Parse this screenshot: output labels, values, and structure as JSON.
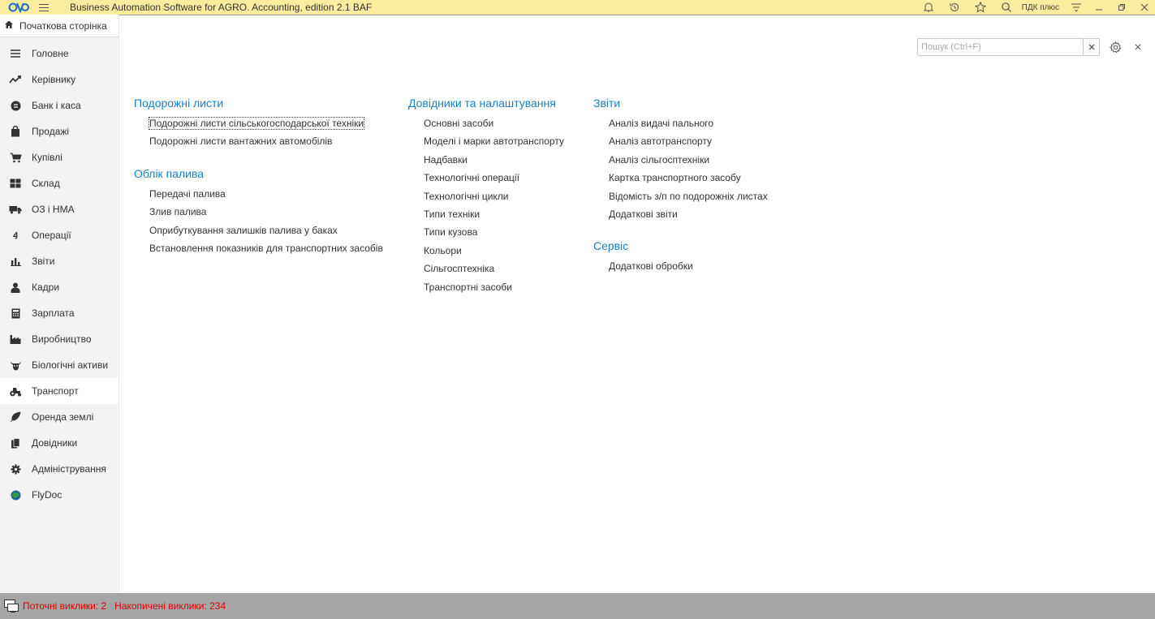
{
  "titlebar": {
    "title": "Business Automation Software for AGRO. Accounting, edition 2.1 BAF",
    "user": "ПДК плюс"
  },
  "sidebar": {
    "home_tab": "Початкова сторінка",
    "items": [
      {
        "label": "Головне",
        "icon": "menu-lines-icon"
      },
      {
        "label": "Керівнику",
        "icon": "trend-chart-icon"
      },
      {
        "label": "Банк і каса",
        "icon": "bank-coin-icon"
      },
      {
        "label": "Продажі",
        "icon": "shopping-bag-icon"
      },
      {
        "label": "Купівлі",
        "icon": "cart-icon"
      },
      {
        "label": "Склад",
        "icon": "warehouse-icon"
      },
      {
        "label": "ОЗ і НМА",
        "icon": "truck-icon"
      },
      {
        "label": "Операції",
        "icon": "operations-icon"
      },
      {
        "label": "Звіти",
        "icon": "bar-chart-icon"
      },
      {
        "label": "Кадри",
        "icon": "person-icon"
      },
      {
        "label": "Зарплата",
        "icon": "calculator-icon"
      },
      {
        "label": "Виробництво",
        "icon": "factory-icon"
      },
      {
        "label": "Біологічні активи",
        "icon": "cow-icon"
      },
      {
        "label": "Транспорт",
        "icon": "tractor-icon",
        "active": true
      },
      {
        "label": "Оренда землі",
        "icon": "feather-icon"
      },
      {
        "label": "Довідники",
        "icon": "books-icon"
      },
      {
        "label": "Адміністрування",
        "icon": "gear-icon"
      },
      {
        "label": "FlyDoc",
        "icon": "flydoc-icon"
      }
    ]
  },
  "search": {
    "placeholder": "Пошук (Ctrl+F)",
    "value": ""
  },
  "columns": [
    {
      "groups": [
        {
          "title": "Подорожні листи",
          "links": [
            "Подорожні листи сільськогосподарської техніки",
            "Подорожні листи вантажних автомобілів"
          ]
        },
        {
          "title": "Облік палива",
          "links": [
            "Передачі палива",
            "Злив палива",
            "Оприбуткування залишків палива у баках",
            "Встановлення показників для транспортних засобів"
          ]
        }
      ]
    },
    {
      "groups": [
        {
          "title": "Довідники та налаштування",
          "links": [
            "Основні засоби",
            "Моделі і марки автотранспорту",
            "Надбавки",
            "Технологічні операції",
            "Технологічні цикли",
            "Типи техніки",
            "Типи кузова",
            "Кольори",
            "Сільгосптехніка",
            "Транспортні засоби"
          ]
        }
      ]
    },
    {
      "groups": [
        {
          "title": "Звіти",
          "links": [
            "Аналіз видачі пального",
            "Аналіз автотранспорту",
            "Аналіз сільгосптехніки",
            "Картка транспортного засобу",
            "Відомість з/п по подорожніх листах",
            "Додаткові звіти"
          ]
        },
        {
          "title": "Сервіс",
          "links": [
            "Додаткові обробки"
          ]
        }
      ]
    }
  ],
  "statusbar": {
    "current_calls": "Поточні виклики: 2",
    "accumulated_calls": "Накопичені виклики: 234"
  },
  "colors": {
    "titlebar_bg": "#fbed9e",
    "group_title": "#1a7fc4",
    "status_text": "#e00000",
    "statusbar_bg": "#a6a6a6"
  }
}
